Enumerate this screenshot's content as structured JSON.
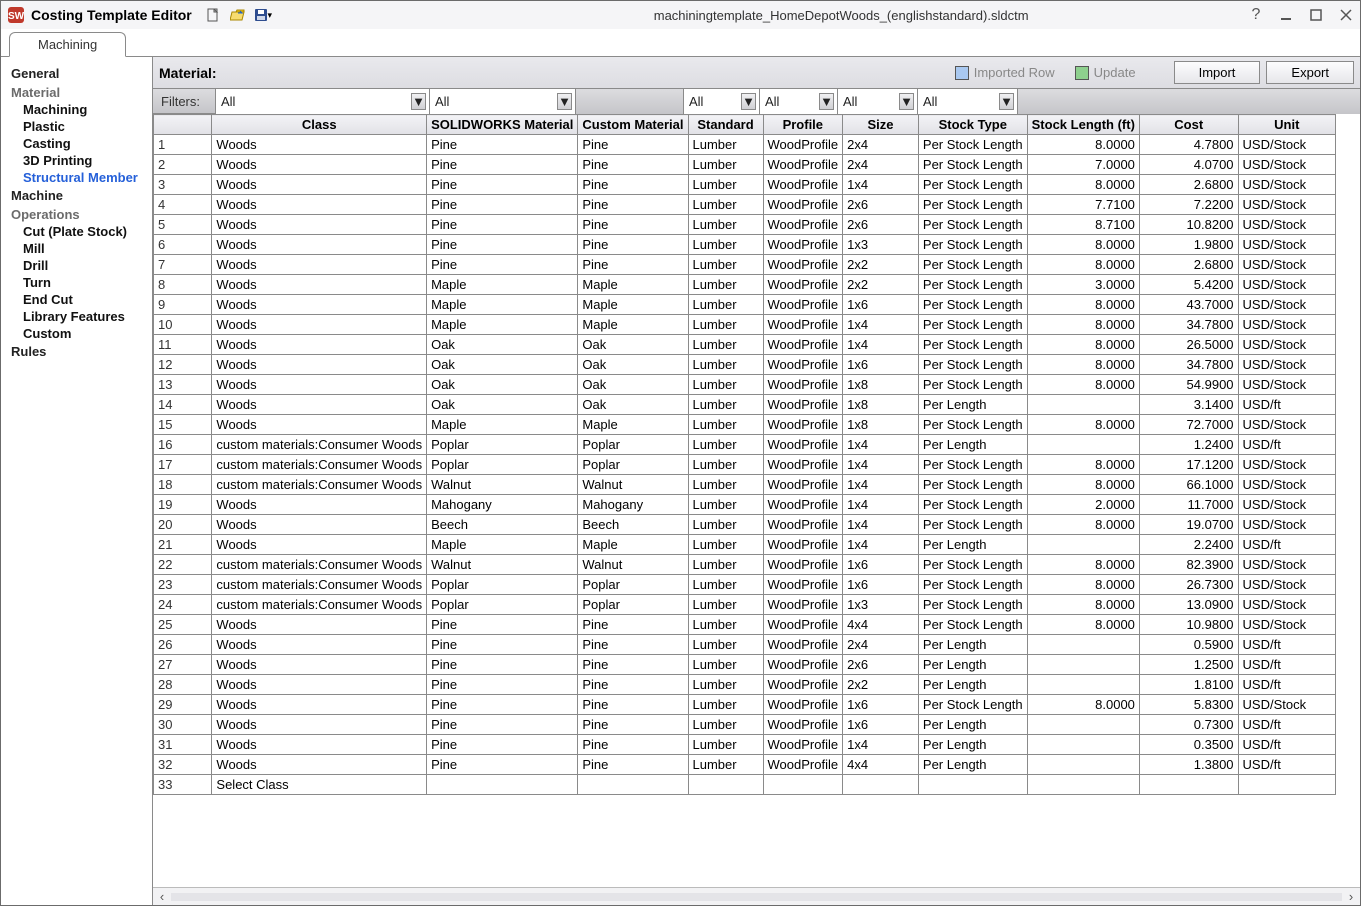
{
  "header": {
    "app_title": "Costing Template Editor",
    "doc_name": "machiningtemplate_HomeDepotWoods_(englishstandard).sldctm",
    "tab": "Machining"
  },
  "sidebar": {
    "general": "General",
    "material": "Material",
    "machining": "Machining",
    "plastic": "Plastic",
    "casting": "Casting",
    "printing3d": "3D Printing",
    "structural": "Structural Member",
    "machine": "Machine",
    "operations": "Operations",
    "cut_plate": "Cut (Plate Stock)",
    "mill": "Mill",
    "drill": "Drill",
    "turn": "Turn",
    "end_cut": "End Cut",
    "library": "Library Features",
    "custom": "Custom",
    "rules": "Rules"
  },
  "bar": {
    "material": "Material:",
    "imported_row": "Imported Row",
    "update": "Update",
    "import_btn": "Import",
    "export_btn": "Export",
    "filters_label": "Filters:"
  },
  "filters": {
    "class": "All",
    "sw": "All",
    "custom": "",
    "standard": "All",
    "profile": "All",
    "size": "All",
    "stock": "All"
  },
  "columns": {
    "row": "",
    "class": "Class",
    "sw": "SOLIDWORKS Material",
    "custom": "Custom Material",
    "standard": "Standard",
    "profile": "Profile",
    "size": "Size",
    "stock": "Stock Type",
    "slen": "Stock Length (ft)",
    "cost": "Cost",
    "unit": "Unit"
  },
  "rows": [
    {
      "n": "1",
      "class": "Woods",
      "sw": "Pine",
      "cust": "Pine",
      "std": "Lumber",
      "prof": "WoodProfile",
      "size": "2x4",
      "stype": "Per Stock Length",
      "slen": "8.0000",
      "cost": "4.7800",
      "unit": "USD/Stock"
    },
    {
      "n": "2",
      "class": "Woods",
      "sw": "Pine",
      "cust": "Pine",
      "std": "Lumber",
      "prof": "WoodProfile",
      "size": "2x4",
      "stype": "Per Stock Length",
      "slen": "7.0000",
      "cost": "4.0700",
      "unit": "USD/Stock"
    },
    {
      "n": "3",
      "class": "Woods",
      "sw": "Pine",
      "cust": "Pine",
      "std": "Lumber",
      "prof": "WoodProfile",
      "size": "1x4",
      "stype": "Per Stock Length",
      "slen": "8.0000",
      "cost": "2.6800",
      "unit": "USD/Stock"
    },
    {
      "n": "4",
      "class": "Woods",
      "sw": "Pine",
      "cust": "Pine",
      "std": "Lumber",
      "prof": "WoodProfile",
      "size": "2x6",
      "stype": "Per Stock Length",
      "slen": "7.7100",
      "cost": "7.2200",
      "unit": "USD/Stock"
    },
    {
      "n": "5",
      "class": "Woods",
      "sw": "Pine",
      "cust": "Pine",
      "std": "Lumber",
      "prof": "WoodProfile",
      "size": "2x6",
      "stype": "Per Stock Length",
      "slen": "8.7100",
      "cost": "10.8200",
      "unit": "USD/Stock"
    },
    {
      "n": "6",
      "class": "Woods",
      "sw": "Pine",
      "cust": "Pine",
      "std": "Lumber",
      "prof": "WoodProfile",
      "size": "1x3",
      "stype": "Per Stock Length",
      "slen": "8.0000",
      "cost": "1.9800",
      "unit": "USD/Stock"
    },
    {
      "n": "7",
      "class": "Woods",
      "sw": "Pine",
      "cust": "Pine",
      "std": "Lumber",
      "prof": "WoodProfile",
      "size": "2x2",
      "stype": "Per Stock Length",
      "slen": "8.0000",
      "cost": "2.6800",
      "unit": "USD/Stock"
    },
    {
      "n": "8",
      "class": "Woods",
      "sw": "Maple",
      "cust": "Maple",
      "std": "Lumber",
      "prof": "WoodProfile",
      "size": "2x2",
      "stype": "Per Stock Length",
      "slen": "3.0000",
      "cost": "5.4200",
      "unit": "USD/Stock"
    },
    {
      "n": "9",
      "class": "Woods",
      "sw": "Maple",
      "cust": "Maple",
      "std": "Lumber",
      "prof": "WoodProfile",
      "size": "1x6",
      "stype": "Per Stock Length",
      "slen": "8.0000",
      "cost": "43.7000",
      "unit": "USD/Stock"
    },
    {
      "n": "10",
      "class": "Woods",
      "sw": "Maple",
      "cust": "Maple",
      "std": "Lumber",
      "prof": "WoodProfile",
      "size": "1x4",
      "stype": "Per Stock Length",
      "slen": "8.0000",
      "cost": "34.7800",
      "unit": "USD/Stock"
    },
    {
      "n": "11",
      "class": "Woods",
      "sw": "Oak",
      "cust": "Oak",
      "std": "Lumber",
      "prof": "WoodProfile",
      "size": "1x4",
      "stype": "Per Stock Length",
      "slen": "8.0000",
      "cost": "26.5000",
      "unit": "USD/Stock"
    },
    {
      "n": "12",
      "class": "Woods",
      "sw": "Oak",
      "cust": "Oak",
      "std": "Lumber",
      "prof": "WoodProfile",
      "size": "1x6",
      "stype": "Per Stock Length",
      "slen": "8.0000",
      "cost": "34.7800",
      "unit": "USD/Stock"
    },
    {
      "n": "13",
      "class": "Woods",
      "sw": "Oak",
      "cust": "Oak",
      "std": "Lumber",
      "prof": "WoodProfile",
      "size": "1x8",
      "stype": "Per Stock Length",
      "slen": "8.0000",
      "cost": "54.9900",
      "unit": "USD/Stock"
    },
    {
      "n": "14",
      "class": "Woods",
      "sw": "Oak",
      "cust": "Oak",
      "std": "Lumber",
      "prof": "WoodProfile",
      "size": "1x8",
      "stype": "Per Length",
      "slen": "",
      "cost": "3.1400",
      "unit": "USD/ft"
    },
    {
      "n": "15",
      "class": "Woods",
      "sw": "Maple",
      "cust": "Maple",
      "std": "Lumber",
      "prof": "WoodProfile",
      "size": "1x8",
      "stype": "Per Stock Length",
      "slen": "8.0000",
      "cost": "72.7000",
      "unit": "USD/Stock"
    },
    {
      "n": "16",
      "class": "custom materials:Consumer Woods",
      "sw": "Poplar",
      "cust": "Poplar",
      "std": "Lumber",
      "prof": "WoodProfile",
      "size": "1x4",
      "stype": "Per Length",
      "slen": "",
      "cost": "1.2400",
      "unit": "USD/ft"
    },
    {
      "n": "17",
      "class": "custom materials:Consumer Woods",
      "sw": "Poplar",
      "cust": "Poplar",
      "std": "Lumber",
      "prof": "WoodProfile",
      "size": "1x4",
      "stype": "Per Stock Length",
      "slen": "8.0000",
      "cost": "17.1200",
      "unit": "USD/Stock"
    },
    {
      "n": "18",
      "class": "custom materials:Consumer Woods",
      "sw": "Walnut",
      "cust": "Walnut",
      "std": "Lumber",
      "prof": "WoodProfile",
      "size": "1x4",
      "stype": "Per Stock Length",
      "slen": "8.0000",
      "cost": "66.1000",
      "unit": "USD/Stock"
    },
    {
      "n": "19",
      "class": "Woods",
      "sw": "Mahogany",
      "cust": "Mahogany",
      "std": "Lumber",
      "prof": "WoodProfile",
      "size": "1x4",
      "stype": "Per Stock Length",
      "slen": "2.0000",
      "cost": "11.7000",
      "unit": "USD/Stock"
    },
    {
      "n": "20",
      "class": "Woods",
      "sw": "Beech",
      "cust": "Beech",
      "std": "Lumber",
      "prof": "WoodProfile",
      "size": "1x4",
      "stype": "Per Stock Length",
      "slen": "8.0000",
      "cost": "19.0700",
      "unit": "USD/Stock"
    },
    {
      "n": "21",
      "class": "Woods",
      "sw": "Maple",
      "cust": "Maple",
      "std": "Lumber",
      "prof": "WoodProfile",
      "size": "1x4",
      "stype": "Per Length",
      "slen": "",
      "cost": "2.2400",
      "unit": "USD/ft"
    },
    {
      "n": "22",
      "class": "custom materials:Consumer Woods",
      "sw": "Walnut",
      "cust": "Walnut",
      "std": "Lumber",
      "prof": "WoodProfile",
      "size": "1x6",
      "stype": "Per Stock Length",
      "slen": "8.0000",
      "cost": "82.3900",
      "unit": "USD/Stock"
    },
    {
      "n": "23",
      "class": "custom materials:Consumer Woods",
      "sw": "Poplar",
      "cust": "Poplar",
      "std": "Lumber",
      "prof": "WoodProfile",
      "size": "1x6",
      "stype": "Per Stock Length",
      "slen": "8.0000",
      "cost": "26.7300",
      "unit": "USD/Stock"
    },
    {
      "n": "24",
      "class": "custom materials:Consumer Woods",
      "sw": "Poplar",
      "cust": "Poplar",
      "std": "Lumber",
      "prof": "WoodProfile",
      "size": "1x3",
      "stype": "Per Stock Length",
      "slen": "8.0000",
      "cost": "13.0900",
      "unit": "USD/Stock"
    },
    {
      "n": "25",
      "class": "Woods",
      "sw": "Pine",
      "cust": "Pine",
      "std": "Lumber",
      "prof": "WoodProfile",
      "size": "4x4",
      "stype": "Per Stock Length",
      "slen": "8.0000",
      "cost": "10.9800",
      "unit": "USD/Stock"
    },
    {
      "n": "26",
      "class": "Woods",
      "sw": "Pine",
      "cust": "Pine",
      "std": "Lumber",
      "prof": "WoodProfile",
      "size": "2x4",
      "stype": "Per Length",
      "slen": "",
      "cost": "0.5900",
      "unit": "USD/ft"
    },
    {
      "n": "27",
      "class": "Woods",
      "sw": "Pine",
      "cust": "Pine",
      "std": "Lumber",
      "prof": "WoodProfile",
      "size": "2x6",
      "stype": "Per Length",
      "slen": "",
      "cost": "1.2500",
      "unit": "USD/ft"
    },
    {
      "n": "28",
      "class": "Woods",
      "sw": "Pine",
      "cust": "Pine",
      "std": "Lumber",
      "prof": "WoodProfile",
      "size": "2x2",
      "stype": "Per Length",
      "slen": "",
      "cost": "1.8100",
      "unit": "USD/ft"
    },
    {
      "n": "29",
      "class": "Woods",
      "sw": "Pine",
      "cust": "Pine",
      "std": "Lumber",
      "prof": "WoodProfile",
      "size": "1x6",
      "stype": "Per Stock Length",
      "slen": "8.0000",
      "cost": "5.8300",
      "unit": "USD/Stock"
    },
    {
      "n": "30",
      "class": "Woods",
      "sw": "Pine",
      "cust": "Pine",
      "std": "Lumber",
      "prof": "WoodProfile",
      "size": "1x6",
      "stype": "Per Length",
      "slen": "",
      "cost": "0.7300",
      "unit": "USD/ft"
    },
    {
      "n": "31",
      "class": "Woods",
      "sw": "Pine",
      "cust": "Pine",
      "std": "Lumber",
      "prof": "WoodProfile",
      "size": "1x4",
      "stype": "Per Length",
      "slen": "",
      "cost": "0.3500",
      "unit": "USD/ft"
    },
    {
      "n": "32",
      "class": "Woods",
      "sw": "Pine",
      "cust": "Pine",
      "std": "Lumber",
      "prof": "WoodProfile",
      "size": "4x4",
      "stype": "Per Length",
      "slen": "",
      "cost": "1.3800",
      "unit": "USD/ft"
    },
    {
      "n": "33",
      "class": "Select Class",
      "sw": "",
      "cust": "",
      "std": "",
      "prof": "",
      "size": "",
      "stype": "",
      "slen": "",
      "cost": "",
      "unit": ""
    }
  ]
}
